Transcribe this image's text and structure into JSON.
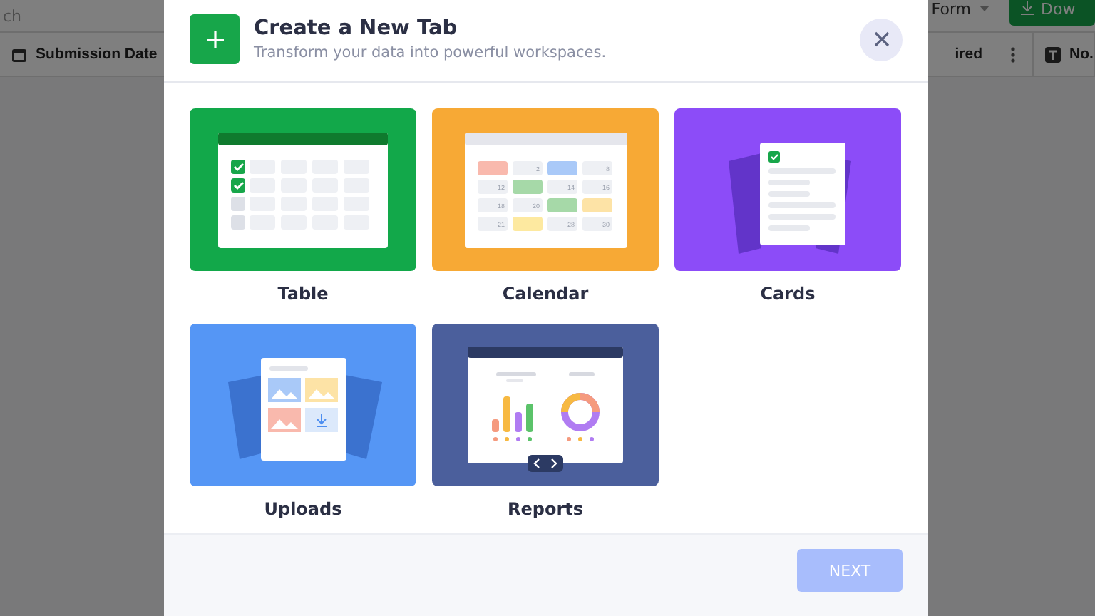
{
  "background_page": {
    "search_text": "ch",
    "form_dropdown": "Form",
    "download_button": "Dow",
    "columns": [
      {
        "label": "Submission Date"
      },
      {
        "label": "ired"
      },
      {
        "label": "No."
      }
    ]
  },
  "dialog": {
    "title": "Create a New Tab",
    "subtitle": "Transform your data into powerful workspaces.",
    "options": [
      {
        "kind": "table",
        "label": "Table",
        "color": "#12a84a"
      },
      {
        "kind": "calendar",
        "label": "Calendar",
        "color": "#f7a935"
      },
      {
        "kind": "cards",
        "label": "Cards",
        "color": "#8c4cf8"
      },
      {
        "kind": "uploads",
        "label": "Uploads",
        "color": "#5596f5"
      },
      {
        "kind": "reports",
        "label": "Reports",
        "color": "#4b5f9c"
      }
    ],
    "calendar_cells": [
      {
        "color": "#f9b9ad"
      },
      {
        "label": "2",
        "color": "#eef0f4"
      },
      {
        "color": "#a9c9f8"
      },
      {
        "label": "8",
        "color": "#eef0f4"
      },
      {
        "label": "12",
        "color": "#eef0f4"
      },
      {
        "color": "#a6d9a8"
      },
      {
        "label": "14",
        "color": "#eef0f4"
      },
      {
        "label": "16",
        "color": "#eef0f4"
      },
      {
        "label": "18",
        "color": "#eef0f4"
      },
      {
        "label": "20",
        "color": "#eef0f4"
      },
      {
        "color": "#a6d9a8"
      },
      {
        "color": "#fde3a6"
      },
      {
        "label": "21",
        "color": "#eef0f4"
      },
      {
        "color": "#fde9a0"
      },
      {
        "label": "28",
        "color": "#eef0f4"
      },
      {
        "label": "30",
        "color": "#eef0f4"
      }
    ],
    "next_button": {
      "label": "NEXT",
      "disabled": true
    }
  }
}
